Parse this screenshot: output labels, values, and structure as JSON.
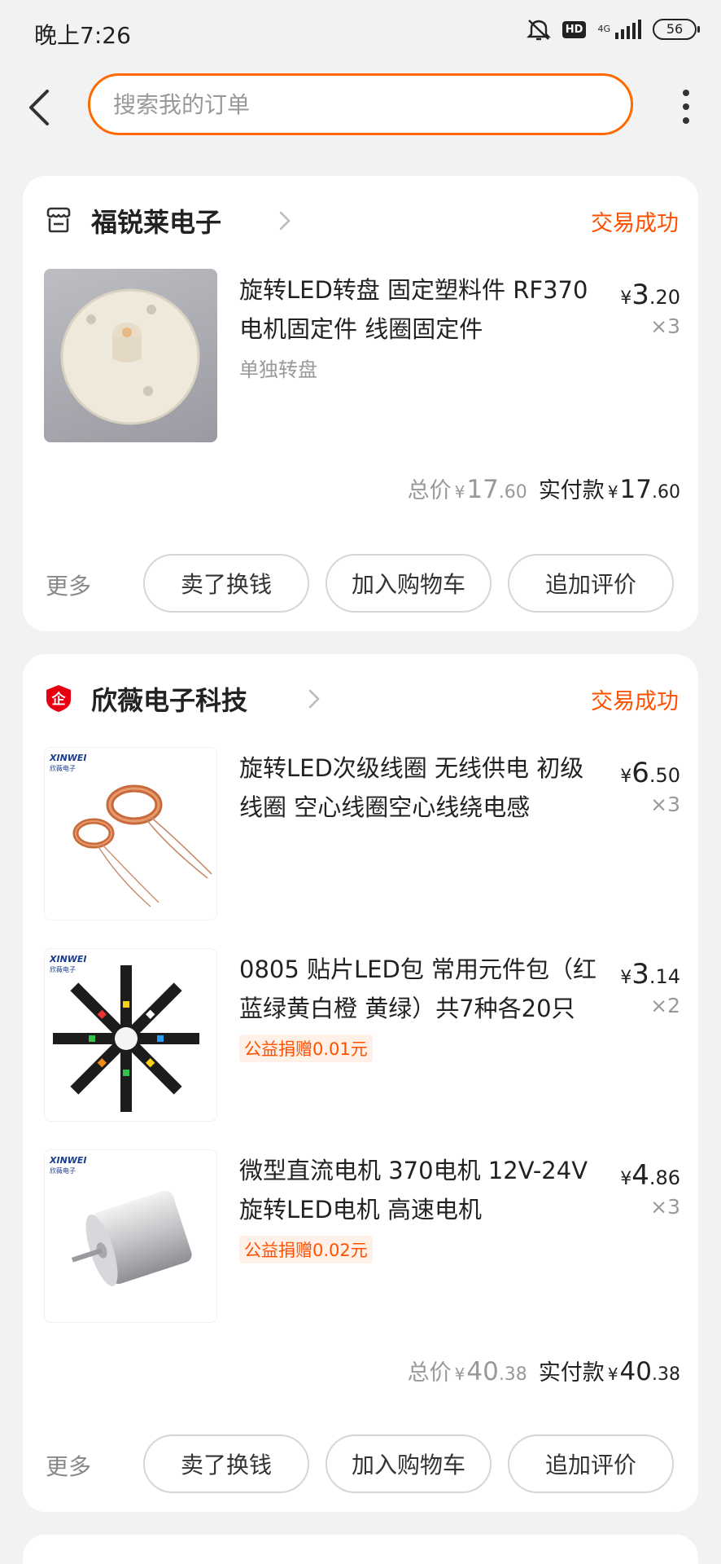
{
  "status_bar": {
    "time": "晚上7:26",
    "hd": "HD",
    "network": "4G",
    "battery": "56"
  },
  "search": {
    "placeholder": "搜索我的订单"
  },
  "orders": [
    {
      "shop_name": "福锐莱电子",
      "status": "交易成功",
      "items": [
        {
          "title": "旋转LED转盘 固定塑料件 RF370电机固定件 线圈固定件",
          "spec": "单独转盘",
          "price_int": "3",
          "price_dec": ".20",
          "qty": "×3"
        }
      ],
      "total_label": "总价",
      "total_int": "17",
      "total_dec": ".60",
      "paid_label": "实付款",
      "paid_int": "17",
      "paid_dec": ".60",
      "actions": {
        "more": "更多",
        "sell": "卖了换钱",
        "cart": "加入购物车",
        "review": "追加评价"
      }
    },
    {
      "shop_name": "欣薇电子科技",
      "status": "交易成功",
      "items": [
        {
          "title": "旋转LED次级线圈 无线供电 初级线圈 空心线圈空心线绕电感",
          "price_int": "6",
          "price_dec": ".50",
          "qty": "×3",
          "brand": "XINWEI",
          "brand_sub": "欣薇电子"
        },
        {
          "title": "0805 贴片LED包 常用元件包（红蓝绿黄白橙 黄绿）共7种各20只",
          "charity": "公益捐赠0.01元",
          "price_int": "3",
          "price_dec": ".14",
          "qty": "×2",
          "brand": "XINWEI",
          "brand_sub": "欣薇电子"
        },
        {
          "title": "微型直流电机 370电机 12V-24V 旋转LED电机 高速电机",
          "charity": "公益捐赠0.02元",
          "price_int": "4",
          "price_dec": ".86",
          "qty": "×3",
          "brand": "XINWEI",
          "brand_sub": "欣薇电子"
        }
      ],
      "total_label": "总价",
      "total_int": "40",
      "total_dec": ".38",
      "paid_label": "实付款",
      "paid_int": "40",
      "paid_dec": ".38",
      "actions": {
        "more": "更多",
        "sell": "卖了换钱",
        "cart": "加入购物车",
        "review": "追加评价"
      }
    }
  ],
  "currency": "¥",
  "colors": {
    "accent": "#ff5000",
    "search_border": "#ff6a00",
    "background": "#f2f2f2"
  },
  "icons": [
    "mute-icon",
    "signal-icon",
    "battery-icon",
    "back-icon",
    "more-icon",
    "store-icon",
    "shop-badge-icon",
    "chevron-right-icon"
  ]
}
